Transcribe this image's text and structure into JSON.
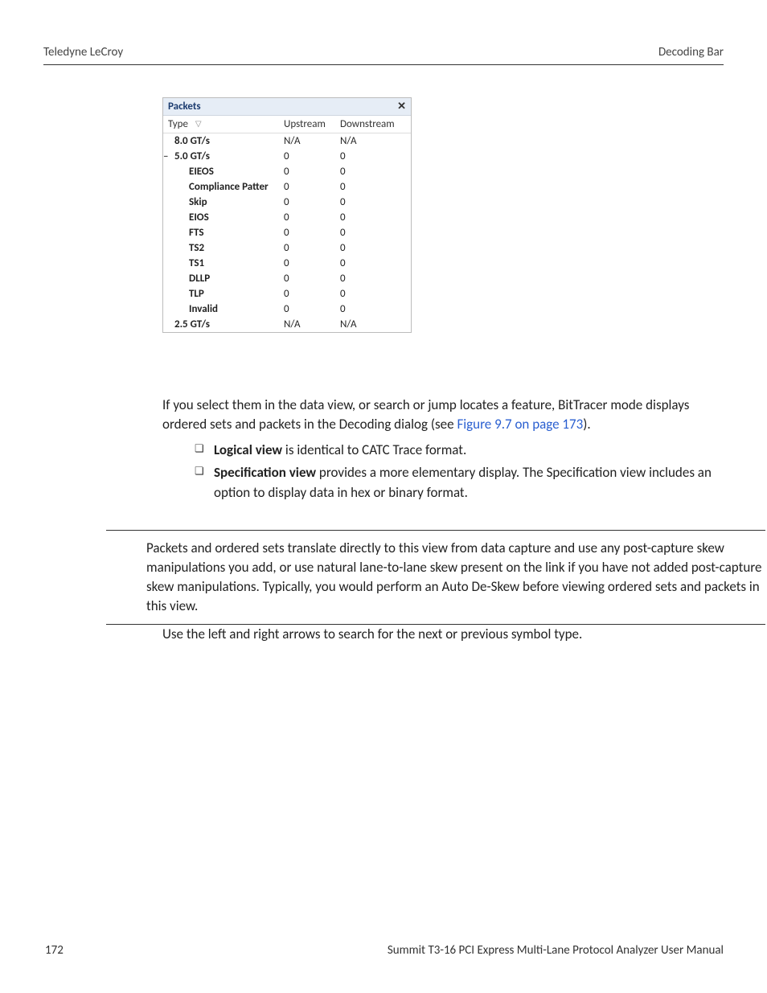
{
  "header": {
    "left": "Teledyne LeCroy",
    "right": "Decoding Bar"
  },
  "panel": {
    "title": "Packets",
    "close": "✕",
    "columns": {
      "c1": "Type",
      "c2": "Upstream",
      "c3": "Downstream"
    },
    "rows": [
      {
        "label": "8.0 GT/s",
        "up": "N/A",
        "down": "N/A",
        "bold": true,
        "indent": 0
      },
      {
        "label": "5.0 GT/s",
        "up": "0",
        "down": "0",
        "bold": true,
        "indent": 0,
        "dash": true
      },
      {
        "label": "EIEOS",
        "up": "0",
        "down": "0",
        "bold": true,
        "indent": 2
      },
      {
        "label": "Compliance Patter",
        "up": "0",
        "down": "0",
        "bold": true,
        "indent": 2,
        "tight": true
      },
      {
        "label": "Skip",
        "up": "0",
        "down": "0",
        "bold": true,
        "indent": 2
      },
      {
        "label": "EIOS",
        "up": "0",
        "down": "0",
        "bold": true,
        "indent": 2
      },
      {
        "label": "FTS",
        "up": "0",
        "down": "0",
        "bold": true,
        "indent": 2
      },
      {
        "label": "TS2",
        "up": "0",
        "down": "0",
        "bold": true,
        "indent": 2
      },
      {
        "label": "TS1",
        "up": "0",
        "down": "0",
        "bold": true,
        "indent": 2
      },
      {
        "label": "DLLP",
        "up": "0",
        "down": "0",
        "bold": true,
        "indent": 2
      },
      {
        "label": "TLP",
        "up": "0",
        "down": "0",
        "bold": true,
        "indent": 2
      },
      {
        "label": "Invalid",
        "up": "0",
        "down": "0",
        "bold": true,
        "indent": 2
      },
      {
        "label": "2.5 GT/s",
        "up": "N/A",
        "down": "N/A",
        "bold": true,
        "indent": 0
      }
    ]
  },
  "body": {
    "intro1": "If you select them in the data view, or search or jump locates a feature, BitTracer mode displays ordered sets and packets in the Decoding dialog (see ",
    "linkText": "Figure 9.7 on page 173",
    "intro2": ").",
    "bullet1_bold": "Logical view",
    "bullet1_rest": " is identical to CATC Trace format.",
    "bullet2_bold": "Specification view",
    "bullet2_rest": " provides a more elementary display. The Specification view includes an option to display data in hex or binary format.",
    "note": "Packets and ordered sets translate directly to this view from data capture and use any post-capture skew manipulations you add, or use natural lane-to-lane skew present on the link if you have not added post-capture skew manipulations. Typically, you would perform an Auto De-Skew before viewing ordered sets and packets in this view.",
    "afterNote": "Use the left and right arrows to search for the next or previous symbol type."
  },
  "footer": {
    "pageNum": "172",
    "title": "Summit T3-16 PCI Express Multi-Lane Protocol Analyzer User Manual"
  }
}
